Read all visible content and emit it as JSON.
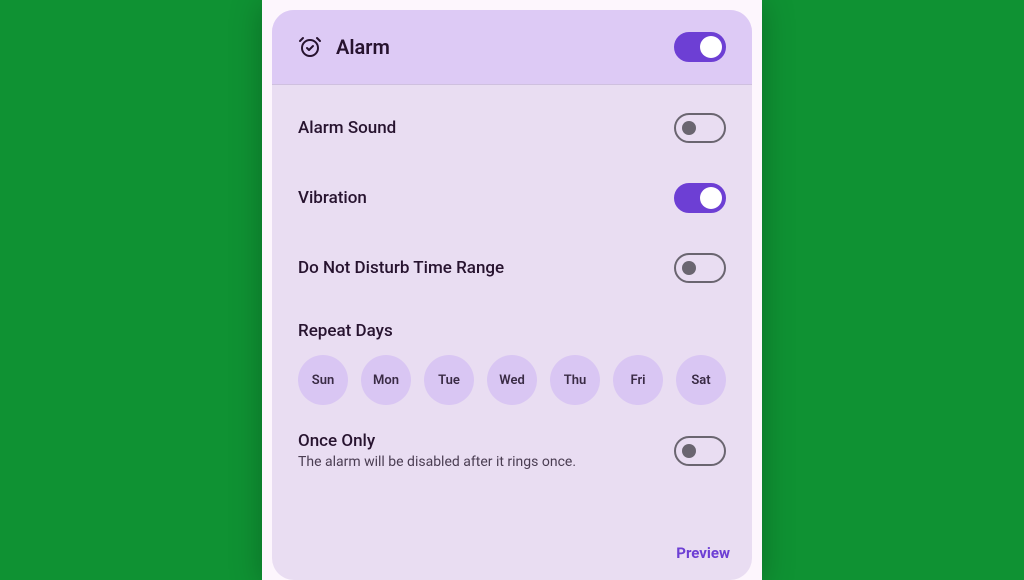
{
  "header": {
    "title": "Alarm",
    "master_enabled": true
  },
  "settings": {
    "alarm_sound": {
      "label": "Alarm Sound",
      "enabled": false
    },
    "vibration": {
      "label": "Vibration",
      "enabled": true
    },
    "dnd_range": {
      "label": "Do Not Disturb Time Range",
      "enabled": false
    },
    "repeat_label": "Repeat Days",
    "days": [
      "Sun",
      "Mon",
      "Tue",
      "Wed",
      "Thu",
      "Fri",
      "Sat"
    ],
    "once_only": {
      "label": "Once Only",
      "subtitle": "The alarm will be disabled after it rings once.",
      "enabled": false
    }
  },
  "footer": {
    "preview": "Preview"
  }
}
